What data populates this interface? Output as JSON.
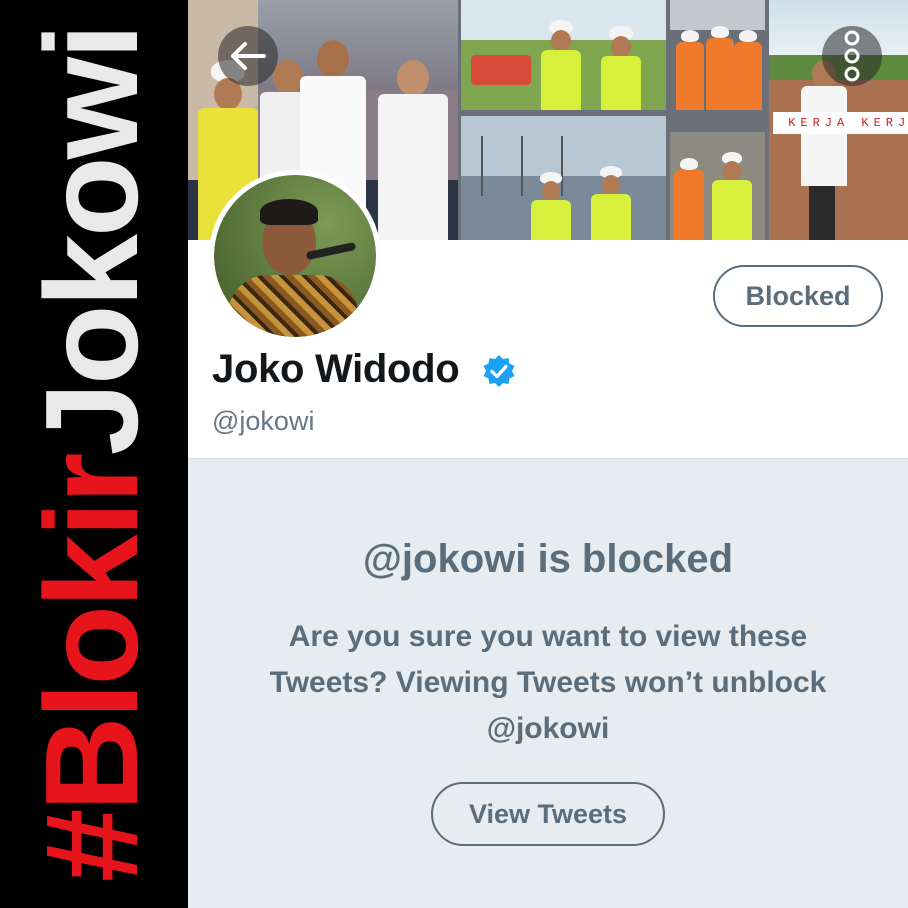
{
  "banner": {
    "hashtag_symbol": "#",
    "hashtag_text": "BlokirJokowi",
    "hash_color": "#e8141c",
    "text_color": "#e9e9e9"
  },
  "header": {
    "tagline": "KERJA KERJA KERJA!",
    "back_icon": "arrow-left-icon",
    "more_icon": "more-vertical-icon"
  },
  "profile": {
    "display_name": "Joko Widodo",
    "verified": true,
    "verified_color": "#1da1f2",
    "handle": "@jokowi",
    "blocked_label": "Blocked"
  },
  "notice": {
    "title": "@jokowi is blocked",
    "body": "Are you sure you want to view these Tweets? Viewing Tweets won’t unblock @jokowi",
    "view_button_label": "View Tweets"
  },
  "colors": {
    "notice_bg": "#e6ecf0",
    "muted_text": "#5b6d7b",
    "handle_text": "#657786"
  }
}
